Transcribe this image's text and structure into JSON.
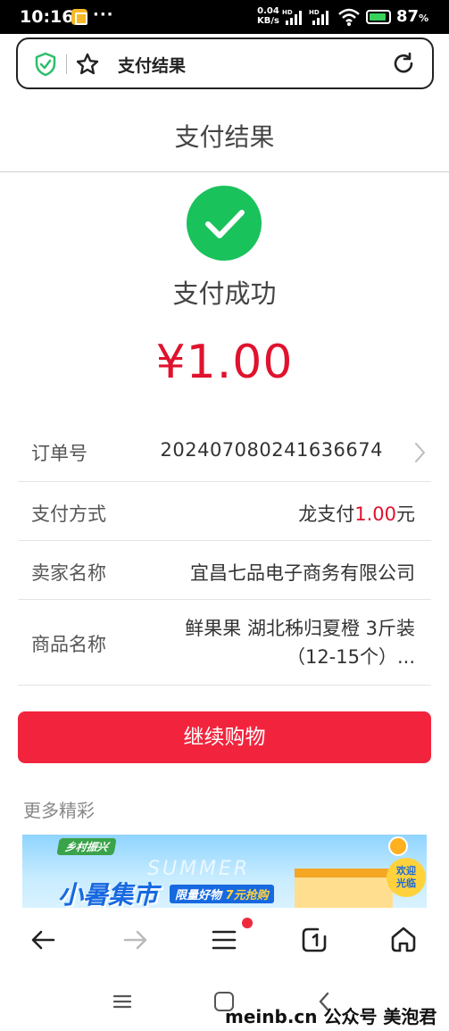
{
  "status_bar": {
    "time": "10:16",
    "dots": "···",
    "speed_value": "0.04",
    "speed_unit": "KB/s",
    "signal_1_label": "HD",
    "signal_2_label": "HD",
    "battery_percent": "87",
    "battery_percent_sign": "%"
  },
  "address_bar": {
    "title": "支付结果"
  },
  "page": {
    "title": "支付结果",
    "success_text": "支付成功",
    "amount": "¥1.00"
  },
  "info": {
    "order": {
      "label": "订单号",
      "value": "2024070802416366​74"
    },
    "payment": {
      "label": "支付方式",
      "method": "龙支付",
      "amount": "1.00",
      "unit": "元"
    },
    "seller": {
      "label": "卖家名称",
      "value": "宜昌七品电子商务有限公司"
    },
    "goods": {
      "label": "商品名称",
      "value_line1": "鲜果果 湖北秭归夏橙 3斤装",
      "value_line2": "（12-15个）..."
    }
  },
  "continue_button": "继续购物",
  "more_section": {
    "title": "更多精彩",
    "banner": {
      "tag": "乡村振兴",
      "title": "小暑集市",
      "badge_text": "限量好物",
      "badge_highlight": "7元抢购",
      "background_word": "SUMMER",
      "sticker_line1": "欢迎",
      "sticker_line2": "光临"
    }
  },
  "watermark": "meinb.cn 公众号 美泡君",
  "colors": {
    "accent_red": "#e0122e",
    "button_red": "#f2243d",
    "success_green": "#19c25b"
  },
  "icons": [
    "shield-icon",
    "star-icon",
    "refresh-icon",
    "check-icon",
    "chevron-right-icon",
    "back-arrow-icon",
    "forward-arrow-icon",
    "menu-icon",
    "tabs-icon",
    "home-icon"
  ]
}
